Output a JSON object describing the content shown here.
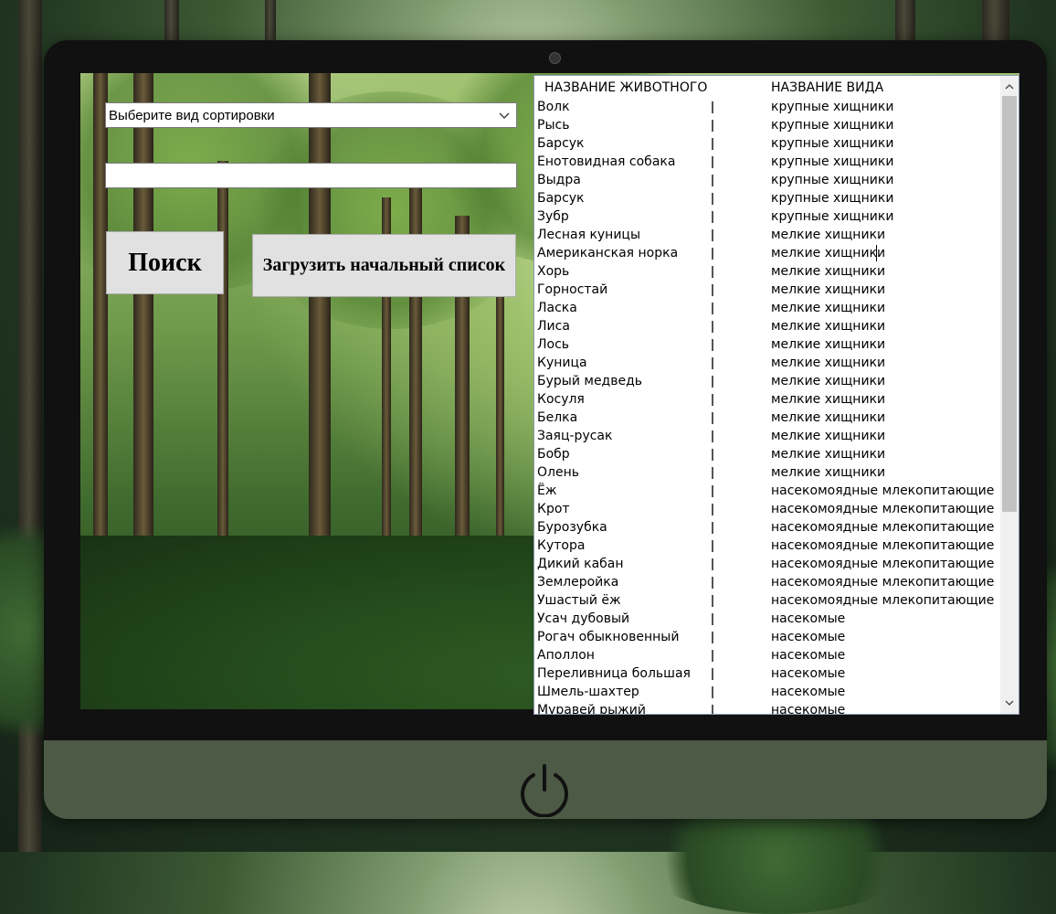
{
  "sort": {
    "selected": "Выберите вид сортировки",
    "chevron_icon": "chevron-down-icon"
  },
  "search": {
    "value": ""
  },
  "buttons": {
    "search_label": "Поиск",
    "load_label": "Загрузить начальный список"
  },
  "list": {
    "header_animal": "НАЗВАНИЕ ЖИВОТНОГО",
    "header_species": "НАЗВАНИЕ ВИДА",
    "rows": [
      {
        "animal": "Волк",
        "species": "крупные хищники"
      },
      {
        "animal": "Рысь",
        "species": "крупные хищники"
      },
      {
        "animal": "Барсук",
        "species": "крупные хищники"
      },
      {
        "animal": "Енотовидная собака",
        "species": "крупные хищники"
      },
      {
        "animal": "Выдра",
        "species": "крупные хищники"
      },
      {
        "animal": "Барсук",
        "species": "крупные хищники"
      },
      {
        "animal": "Зубр",
        "species": "крупные хищники"
      },
      {
        "animal": "Лесная куницы",
        "species": "мелкие хищники"
      },
      {
        "animal": "Американская норка",
        "species": "мелкие хищники"
      },
      {
        "animal": "Хорь",
        "species": "мелкие хищники"
      },
      {
        "animal": "Горностай",
        "species": "мелкие хищники"
      },
      {
        "animal": "Ласка",
        "species": "мелкие хищники"
      },
      {
        "animal": "Лиса",
        "species": "мелкие хищники"
      },
      {
        "animal": "Лось",
        "species": "мелкие хищники"
      },
      {
        "animal": "Куница",
        "species": "мелкие хищники"
      },
      {
        "animal": "Бурый медведь",
        "species": "мелкие хищники"
      },
      {
        "animal": "Косуля",
        "species": "мелкие хищники"
      },
      {
        "animal": "Белка",
        "species": "мелкие хищники"
      },
      {
        "animal": "Заяц-русак",
        "species": "мелкие хищники"
      },
      {
        "animal": "Бобр",
        "species": "мелкие хищники"
      },
      {
        "animal": "Олень",
        "species": "мелкие хищники"
      },
      {
        "animal": "Ёж",
        "species": "насекомоядные млекопитающие"
      },
      {
        "animal": "Крот",
        "species": "насекомоядные млекопитающие"
      },
      {
        "animal": "Бурозубка",
        "species": "насекомоядные млекопитающие"
      },
      {
        "animal": "Кутора",
        "species": "насекомоядные млекопитающие"
      },
      {
        "animal": "Дикий кабан",
        "species": "насекомоядные млекопитающие"
      },
      {
        "animal": "Землеройка",
        "species": "насекомоядные млекопитающие"
      },
      {
        "animal": "Ушастый ёж",
        "species": "насекомоядные млекопитающие"
      },
      {
        "animal": "Усач дубовый",
        "species": "насекомые"
      },
      {
        "animal": "Рогач обыкновенный",
        "species": "насекомые"
      },
      {
        "animal": "Аполлон",
        "species": "насекомые"
      },
      {
        "animal": "Переливница большая",
        "species": "насекомые"
      },
      {
        "animal": "Шмель-шахтер",
        "species": "насекомые"
      },
      {
        "animal": "Муравей рыжий",
        "species": "насекомые"
      }
    ]
  },
  "icons": {
    "power": "power-icon",
    "scroll_up": "chevron-up-icon",
    "scroll_down": "chevron-down-icon"
  }
}
